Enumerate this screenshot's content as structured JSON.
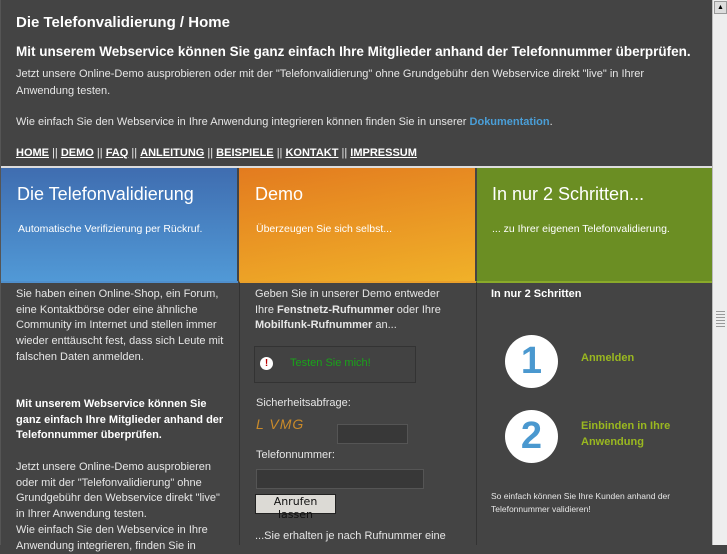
{
  "header": {
    "title": "Die Telefonvalidierung / Home",
    "headline": "Mit unserem Webservice können Sie ganz einfach Ihre Mitglieder anhand der Telefonnummer überprüfen.",
    "intro": "Jetzt unsere Online-Demo ausprobieren oder mit der \"Telefonvalidierung\" ohne Grundgebühr den Webservice direkt \"live\" in Ihrer Anwendung testen.",
    "doc_text": "Wie einfach Sie den Webservice in Ihre Anwendung integrieren können finden Sie in unserer ",
    "doc_link": "Dokumentation",
    "doc_end": "."
  },
  "nav": {
    "items": [
      "HOME",
      "DEMO",
      "FAQ",
      "ANLEITUNG",
      "BEISPIELE",
      "KONTAKT",
      "IMPRESSUM"
    ],
    "separator": "||"
  },
  "banners": [
    {
      "title": "Die Telefonvalidierung",
      "subtitle": "Automatische Verifizierung per Rückruf."
    },
    {
      "title": "Demo",
      "subtitle": "Überzeugen Sie sich selbst..."
    },
    {
      "title": "In nur 2 Schritten...",
      "subtitle": "... zu Ihrer eigenen Telefonvalidierung."
    }
  ],
  "col1": {
    "p1": "Sie haben einen Online-Shop, ein Forum, eine Kontaktbörse oder eine ähnliche Community im Internet und stellen immer wieder enttäuscht fest, dass sich Leute mit falschen Daten anmelden.",
    "p2": "Mit unserem Webservice können Sie ganz einfach Ihre Mitglieder anhand der Telefonnummer überprüfen.",
    "p3": "Jetzt unsere Online-Demo ausprobieren oder mit der \"Telefonvalidierung\" ohne Grundgebühr den Webservice direkt \"live\" in Ihrer Anwendung testen.",
    "p4": "Wie einfach Sie den Webservice in Ihre Anwendung integrieren, finden Sie in"
  },
  "col2": {
    "intro_a": "Geben Sie in unserer Demo entweder Ihre ",
    "bold1": "Fenstnetz-Rufnummer",
    "intro_b": " oder Ihre ",
    "bold2": "Mobilfunk-Rufnummer",
    "intro_c": " an...",
    "test_label": "Testen Sie mich!",
    "security_label": "Sicherheitsabfrage:",
    "captcha": "L  VMG",
    "captcha_value": "",
    "phone_label": "Telefonnummer:",
    "phone_value": "",
    "button": "Anrufen lassen",
    "outro": "...Sie erhalten je nach Rufnummer eine"
  },
  "col3": {
    "title": "In nur 2 Schritten",
    "steps": [
      {
        "number": "1",
        "label": "Anmelden"
      },
      {
        "number": "2",
        "label": "Einbinden in Ihre Anwendung"
      }
    ],
    "footer": "So einfach können Sie Ihre Kunden anhand der Telefonnummer validieren!"
  }
}
